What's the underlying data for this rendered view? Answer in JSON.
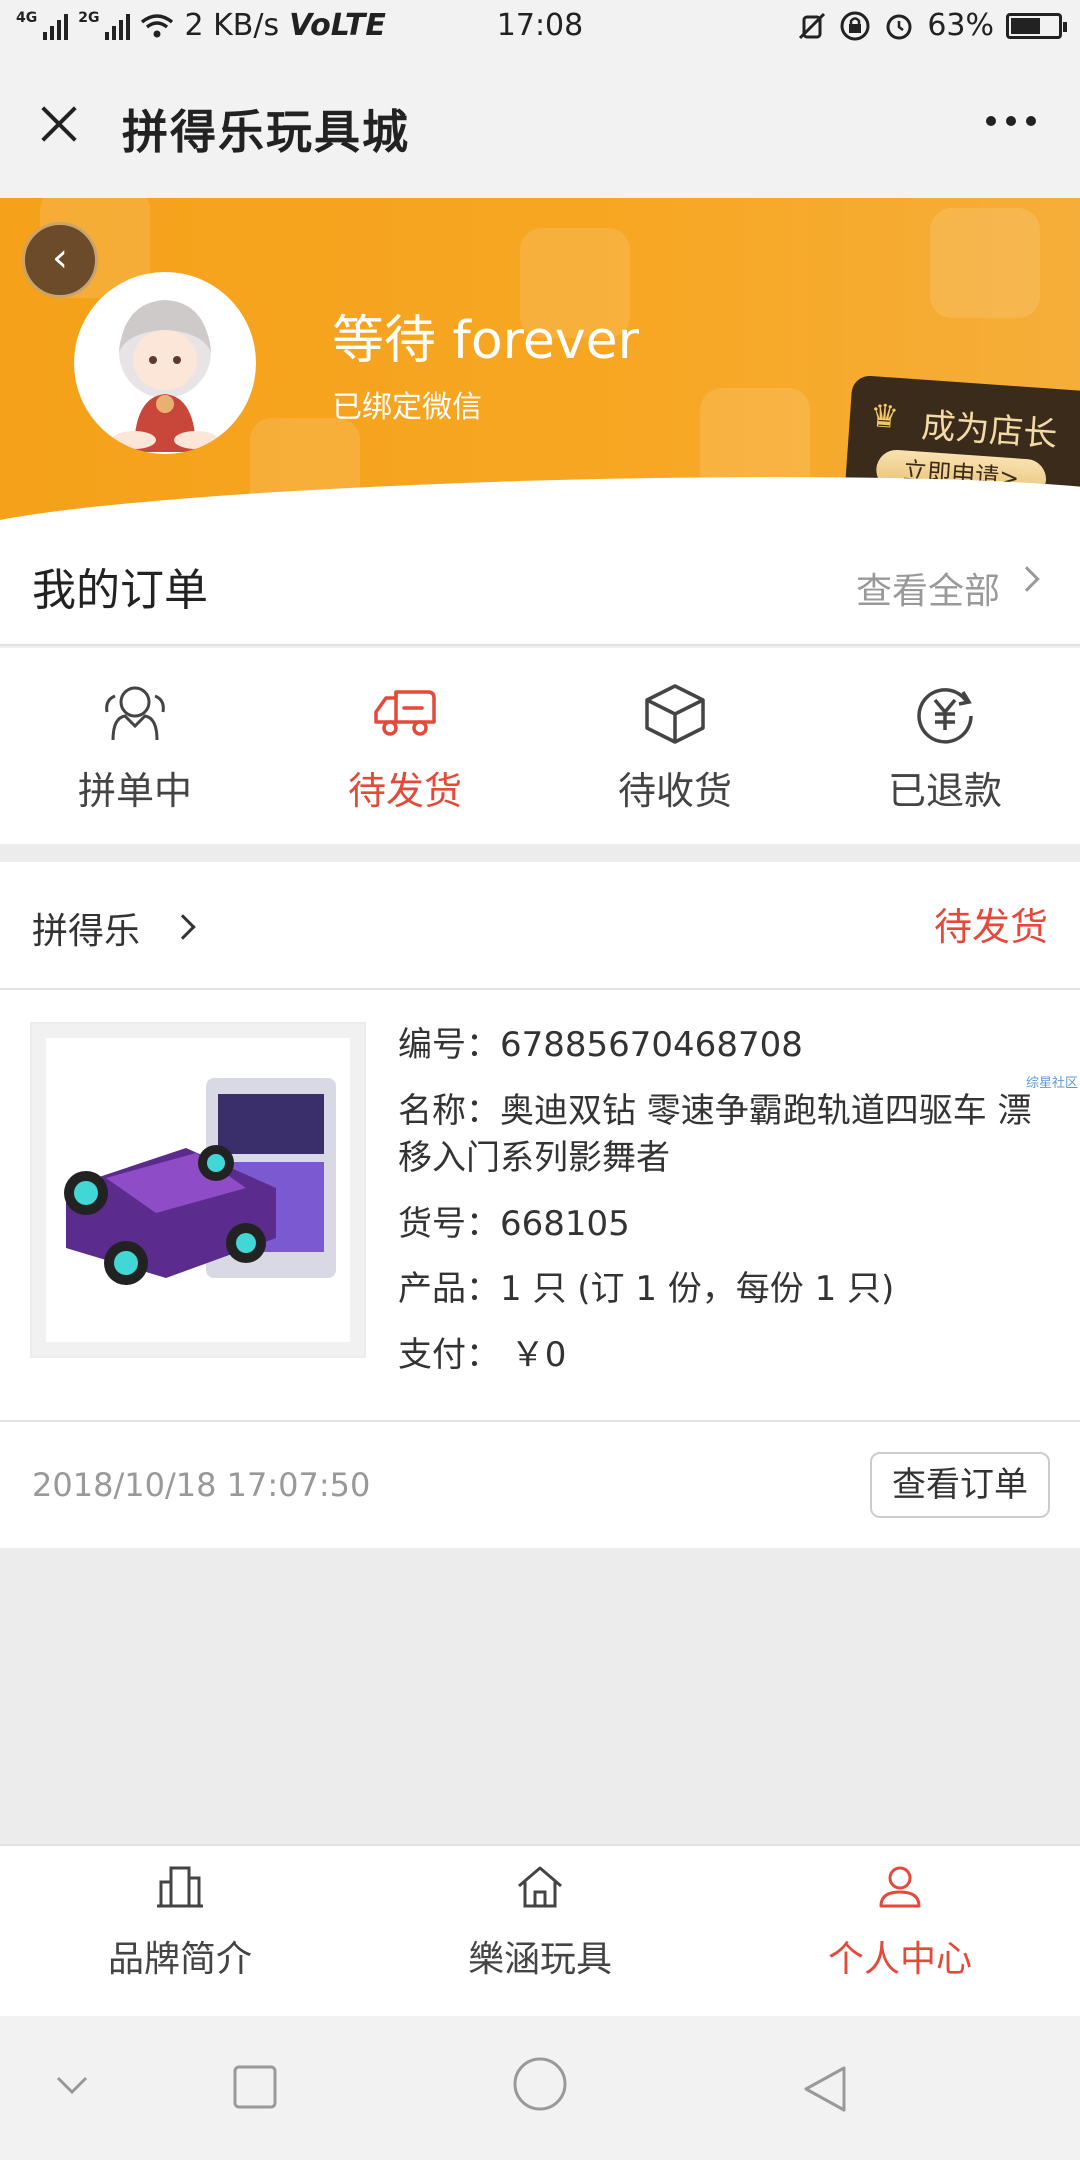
{
  "status_bar": {
    "network_1": "4G",
    "network_2": "2G",
    "speed": "2 KB/s",
    "volte": "VoLTE",
    "time": "17:08",
    "battery": "63%",
    "battery_level": 0.63
  },
  "header": {
    "title": "拼得乐玩具城",
    "close_icon": "close-icon",
    "more_icon": "more-icon"
  },
  "profile": {
    "name": "等待 forever",
    "bind_status": "已绑定微信",
    "shop_owner": {
      "title": "成为店长",
      "apply": "立即申请>"
    }
  },
  "orders": {
    "title": "我的订单",
    "view_all": "查看全部"
  },
  "status_tabs": [
    {
      "label": "拼单中",
      "icon": "group-icon",
      "active": false
    },
    {
      "label": "待发货",
      "icon": "truck-icon",
      "active": true
    },
    {
      "label": "待收货",
      "icon": "box-icon",
      "active": false
    },
    {
      "label": "已退款",
      "icon": "refund-icon",
      "active": false
    }
  ],
  "order": {
    "shop": "拼得乐",
    "status": "待发货",
    "number_line": "编号：67885670468708",
    "name_line": "名称：奥迪双钻 零速争霸跑轨道四驱车 漂移入门系列影舞者",
    "sku_line": "货号：668105",
    "product_line": "产品：1 只 (订 1 份，每份 1 只)",
    "pay_line": "支付： ￥0",
    "time": "2018/10/18 17:07:50",
    "view_button": "查看订单",
    "watermark": "综星社区"
  },
  "bottom_nav": [
    {
      "label": "品牌简介",
      "icon": "building-icon",
      "active": false
    },
    {
      "label": "樂涵玩具",
      "icon": "home-icon",
      "active": false
    },
    {
      "label": "个人中心",
      "icon": "user-icon",
      "active": true
    }
  ],
  "colors": {
    "accent": "#e4493a",
    "banner": "#f5a11a"
  }
}
